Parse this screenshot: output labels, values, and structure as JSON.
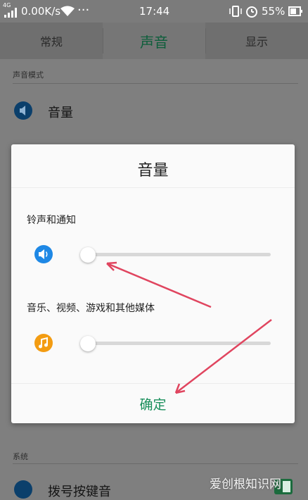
{
  "status_bar": {
    "network": "4G",
    "speed": "0.00K/s",
    "more": "···",
    "time": "17:44",
    "battery_percent": "55%"
  },
  "tabs": [
    {
      "label": "常规",
      "active": false
    },
    {
      "label": "声音",
      "active": true
    },
    {
      "label": "显示",
      "active": false
    }
  ],
  "background": {
    "section_sound_mode": "声音模式",
    "volume_row_label": "音量",
    "section_system": "系统",
    "dial_tone_label": "拨号按键音"
  },
  "dialog": {
    "title": "音量",
    "ringtone_label": "铃声和通知",
    "ringtone_volume": 0,
    "media_label": "音乐、视频、游戏和其他媒体",
    "media_volume": 0,
    "confirm_label": "确定"
  },
  "colors": {
    "accent_green": "#1a8f5c",
    "speaker_blue": "#1e88e5",
    "music_orange": "#f39c12",
    "arrow_red": "#e0455f"
  },
  "watermark": "爱创根知识网"
}
